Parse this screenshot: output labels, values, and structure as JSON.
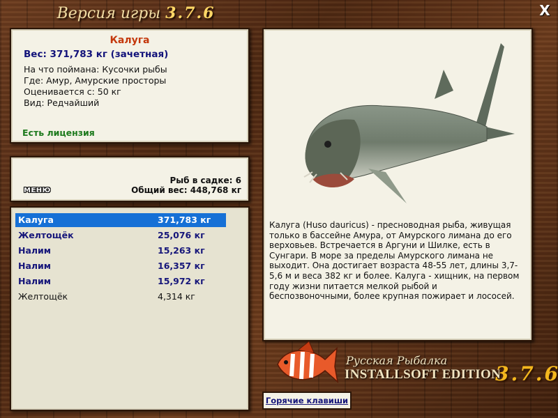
{
  "window": {
    "title_prefix": "Версия игры",
    "title_version": "3.7.6",
    "close_label": "X"
  },
  "info": {
    "fish_name": "Калуга",
    "weight_line": "Вес: 371,783 кг (зачетная)",
    "caught_on": "На что поймана: Кусочки рыбы",
    "where": "Где: Амур, Амурские просторы",
    "rated_from": "Оценивается с: 50 кг",
    "kind": "Вид: Редчайший",
    "license": "Есть лицензия"
  },
  "keep": {
    "menu_label": "МЕНЮ",
    "fish_count": "Рыб в садке: 6",
    "total_weight": "Общий вес: 448,768 кг"
  },
  "catch_list": [
    {
      "name": "Калуга",
      "weight": "371,783 кг",
      "selected": true,
      "highlight": true
    },
    {
      "name": "Желтощёк",
      "weight": "25,076 кг",
      "selected": false,
      "highlight": true
    },
    {
      "name": "Налим",
      "weight": "15,263 кг",
      "selected": false,
      "highlight": true
    },
    {
      "name": "Налим",
      "weight": "16,357 кг",
      "selected": false,
      "highlight": true
    },
    {
      "name": "Налим",
      "weight": "15,972 кг",
      "selected": false,
      "highlight": true
    },
    {
      "name": "Желтощёк",
      "weight": "4,314 кг",
      "selected": false,
      "highlight": false
    }
  ],
  "description": "Калуга (Huso dauricus) - пресноводная рыба, живущая только в бассейне Амура, от Амурского лимана до его верховьев. Встречается в Аргуни и Шилке, есть в Сунгари. В море за пределы Амурского лимана не выходит. Она достигает возраста 48-55 лет, длины 3,7-5,6 м и веса 382 кг и более. Калуга - хищник, на первом году жизни питается мелкой рыбой и беспозвоночными, более крупная пожирает и лососей.",
  "brand": {
    "line1": "Русская Рыбалка",
    "line2": "INSTALLSOFT EDITION",
    "version": "3.7.6"
  },
  "hotkeys_label": "Горячие клавиши",
  "colors": {
    "selected_row": "#1670d6",
    "fish_name": "#c4380c",
    "weight": "#12127a",
    "license": "#1d7a1d"
  }
}
